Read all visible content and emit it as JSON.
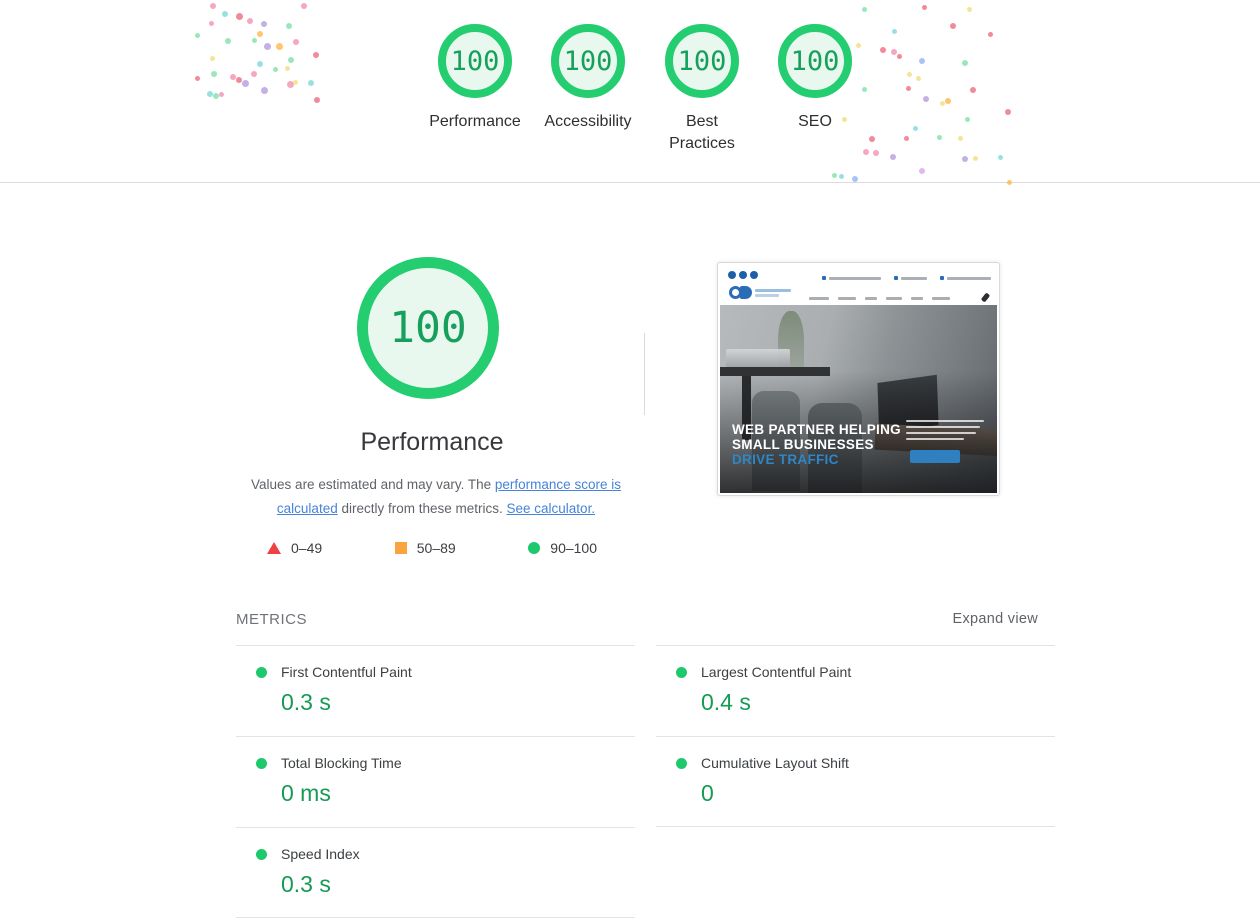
{
  "header": {
    "categories": [
      {
        "label": "Performance",
        "score": "100"
      },
      {
        "label": "Accessibility",
        "score": "100"
      },
      {
        "label": "Best Practices",
        "score": "100"
      },
      {
        "label": "SEO",
        "score": "100"
      }
    ]
  },
  "performance": {
    "score": "100",
    "title": "Performance",
    "disclaimer": {
      "text_1": "Values are estimated and may vary. The ",
      "link_1": "performance score is calculated",
      "text_2": " directly from these metrics. ",
      "link_2": "See calculator."
    },
    "legend": [
      {
        "shape": "triangle",
        "color": "#ef4045",
        "range": "0–49"
      },
      {
        "shape": "square",
        "color": "#f9a43f",
        "range": "50–89"
      },
      {
        "shape": "circle",
        "color": "#1ec96d",
        "range": "90–100"
      }
    ]
  },
  "screenshot": {
    "hero_line_1": "WEB PARTNER HELPING",
    "hero_line_2": "SMALL BUSINESSES",
    "hero_line_3": "DRIVE TRAFFIC"
  },
  "metrics": {
    "section_title": "METRICS",
    "expand_label": "Expand view",
    "items": [
      {
        "label": "First Contentful Paint",
        "value": "0.3 s"
      },
      {
        "label": "Largest Contentful Paint",
        "value": "0.4 s"
      },
      {
        "label": "Total Blocking Time",
        "value": "0 ms"
      },
      {
        "label": "Cumulative Layout Shift",
        "value": "0"
      },
      {
        "label": "Speed Index",
        "value": "0.3 s"
      }
    ]
  },
  "colors": {
    "page_background": "#ffffff",
    "gauge_ring_green": "#23cd70",
    "gauge_fill_green": "#e9f8ef",
    "score_text_green": "#17a05c",
    "metric_value_green": "#169a54",
    "metric_dot_green": "#1ec96d",
    "legend_red": "#ef4045",
    "legend_orange": "#f9a43f",
    "link_blue": "#4683d9",
    "muted_text": "#5f6368",
    "divider": "#e3e3e3"
  },
  "confetti": {
    "palette": [
      "#f291b2",
      "#ef6e7e",
      "#7ee2a8",
      "#f2dd7e",
      "#ffb74d",
      "#b39ddb",
      "#7fd8d8",
      "#92b4f4",
      "#d7a7ee"
    ],
    "dots": [
      [
        210,
        3,
        0,
        6
      ],
      [
        222,
        11,
        6,
        6
      ],
      [
        236,
        13,
        1,
        7
      ],
      [
        247,
        18,
        0,
        6
      ],
      [
        261,
        21,
        5,
        6
      ],
      [
        286,
        23,
        2,
        6
      ],
      [
        301,
        3,
        0,
        6
      ],
      [
        209,
        21,
        0,
        5
      ],
      [
        195,
        33,
        2,
        5
      ],
      [
        225,
        38,
        2,
        6
      ],
      [
        257,
        31,
        4,
        6
      ],
      [
        252,
        38,
        2,
        5
      ],
      [
        264,
        43,
        5,
        7
      ],
      [
        276,
        43,
        4,
        7
      ],
      [
        293,
        39,
        0,
        6
      ],
      [
        313,
        52,
        1,
        6
      ],
      [
        210,
        56,
        3,
        5
      ],
      [
        288,
        57,
        2,
        6
      ],
      [
        257,
        61,
        6,
        6
      ],
      [
        273,
        67,
        2,
        5
      ],
      [
        285,
        66,
        3,
        5
      ],
      [
        195,
        76,
        1,
        5
      ],
      [
        211,
        71,
        2,
        6
      ],
      [
        230,
        74,
        0,
        6
      ],
      [
        236,
        77,
        1,
        6
      ],
      [
        251,
        71,
        0,
        6
      ],
      [
        242,
        80,
        5,
        7
      ],
      [
        287,
        81,
        0,
        7
      ],
      [
        293,
        80,
        3,
        5
      ],
      [
        308,
        80,
        6,
        6
      ],
      [
        261,
        87,
        5,
        7
      ],
      [
        207,
        91,
        6,
        6
      ],
      [
        213,
        93,
        2,
        6
      ],
      [
        219,
        92,
        0,
        5
      ],
      [
        314,
        97,
        1,
        6
      ],
      [
        862,
        7,
        2,
        5
      ],
      [
        922,
        5,
        1,
        5
      ],
      [
        967,
        7,
        3,
        5
      ],
      [
        950,
        23,
        1,
        6
      ],
      [
        892,
        29,
        6,
        5
      ],
      [
        988,
        32,
        1,
        5
      ],
      [
        856,
        43,
        3,
        5
      ],
      [
        880,
        47,
        1,
        6
      ],
      [
        891,
        49,
        0,
        6
      ],
      [
        897,
        54,
        1,
        5
      ],
      [
        919,
        58,
        7,
        6
      ],
      [
        962,
        60,
        2,
        6
      ],
      [
        907,
        72,
        3,
        5
      ],
      [
        916,
        76,
        3,
        5
      ],
      [
        862,
        87,
        2,
        5
      ],
      [
        906,
        86,
        1,
        5
      ],
      [
        970,
        87,
        1,
        6
      ],
      [
        923,
        96,
        5,
        6
      ],
      [
        945,
        98,
        4,
        6
      ],
      [
        940,
        101,
        3,
        5
      ],
      [
        1005,
        109,
        1,
        6
      ],
      [
        842,
        117,
        3,
        5
      ],
      [
        965,
        117,
        2,
        5
      ],
      [
        913,
        126,
        6,
        5
      ],
      [
        869,
        136,
        1,
        6
      ],
      [
        904,
        136,
        1,
        5
      ],
      [
        937,
        135,
        2,
        5
      ],
      [
        958,
        136,
        3,
        5
      ],
      [
        863,
        149,
        0,
        6
      ],
      [
        873,
        150,
        0,
        6
      ],
      [
        890,
        154,
        5,
        6
      ],
      [
        962,
        156,
        5,
        6
      ],
      [
        973,
        156,
        3,
        5
      ],
      [
        998,
        155,
        6,
        5
      ],
      [
        919,
        168,
        8,
        6
      ],
      [
        832,
        173,
        2,
        5
      ],
      [
        839,
        174,
        6,
        5
      ],
      [
        852,
        176,
        7,
        6
      ],
      [
        1007,
        180,
        4,
        5
      ]
    ]
  }
}
